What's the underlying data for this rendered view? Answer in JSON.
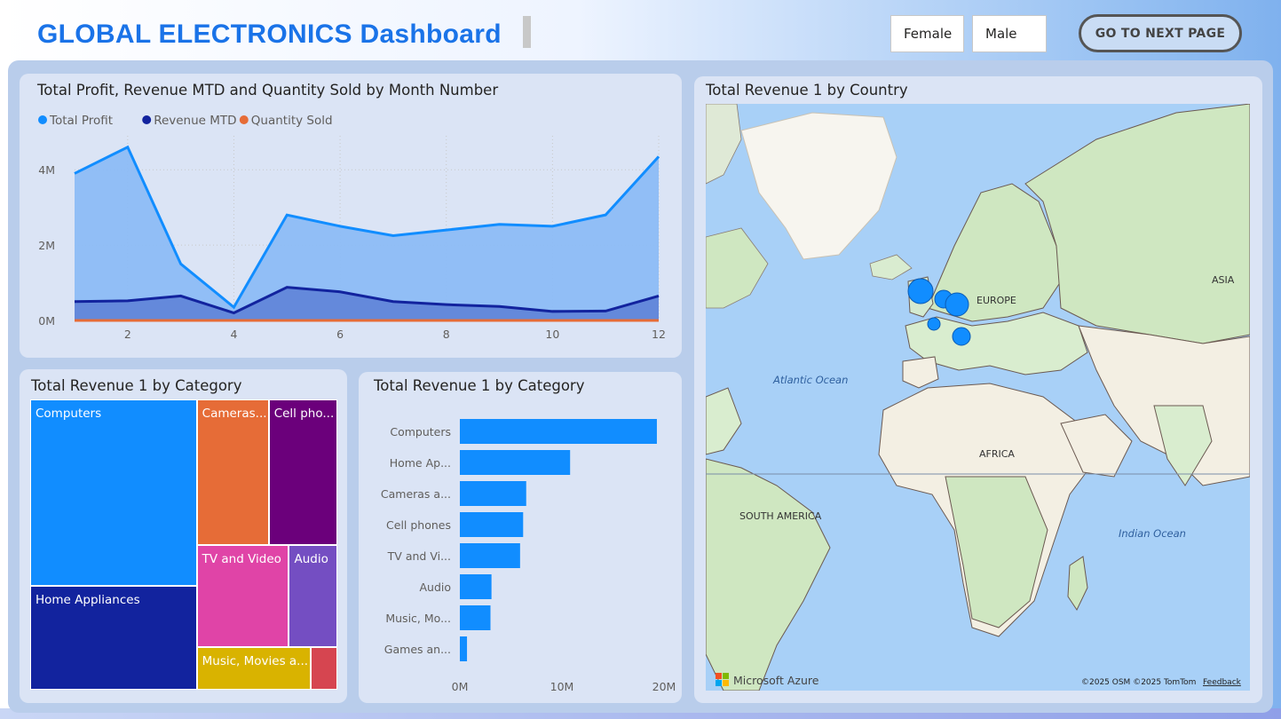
{
  "header": {
    "title": "GLOBAL ELECTRONICS Dashboard",
    "slicer_options": [
      "Female",
      "Male"
    ],
    "next_button": "GO TO NEXT PAGE"
  },
  "line_chart": {
    "title": "Total Profit, Revenue MTD and Quantity Sold by Month Number",
    "legend": [
      {
        "name": "Total Profit",
        "color": "#118DFF"
      },
      {
        "name": "Revenue MTD",
        "color": "#12239E"
      },
      {
        "name": "Quantity Sold",
        "color": "#E66C37"
      }
    ]
  },
  "treemap": {
    "title": "Total Revenue 1 by Category"
  },
  "bar_chart": {
    "title": "Total Revenue 1 by Category"
  },
  "map": {
    "title": "Total Revenue 1 by Country",
    "labels": [
      "EUROPE",
      "ASIA",
      "Atlantic Ocean",
      "AFRICA",
      "SOUTH AMERICA",
      "Indian Ocean"
    ],
    "attribution": "©2025 OSM  ©2025 TomTom",
    "feedback": "Feedback",
    "brand": "Microsoft Azure",
    "bubble_color": "#118DFF"
  },
  "chart_data": [
    {
      "type": "area",
      "title": "Total Profit, Revenue MTD and Quantity Sold by Month Number",
      "x": [
        1,
        2,
        3,
        4,
        5,
        6,
        7,
        8,
        9,
        10,
        11,
        12
      ],
      "xticks": [
        2,
        4,
        6,
        8,
        10,
        12
      ],
      "yticks": [
        "0M",
        "2M",
        "4M"
      ],
      "ylim": [
        0,
        4.9
      ],
      "series": [
        {
          "name": "Total Profit",
          "values": [
            3.9,
            4.6,
            1.5,
            0.35,
            2.8,
            2.5,
            2.25,
            2.4,
            2.55,
            2.5,
            2.8,
            4.35
          ]
        },
        {
          "name": "Revenue MTD",
          "values": [
            0.5,
            0.52,
            0.65,
            0.2,
            0.88,
            0.76,
            0.5,
            0.42,
            0.37,
            0.24,
            0.25,
            0.65
          ]
        },
        {
          "name": "Quantity Sold",
          "values": [
            0,
            0,
            0,
            0,
            0,
            0,
            0,
            0,
            0,
            0,
            0,
            0
          ]
        }
      ],
      "grid": true,
      "legend_position": "top-left"
    },
    {
      "type": "treemap",
      "title": "Total Revenue 1 by Category",
      "categories": [
        "Computers",
        "Home Appliances",
        "Cameras and camcorders",
        "Cell phones",
        "TV and Video",
        "Audio",
        "Music, Movies and Audio Books",
        "Games and Toys"
      ],
      "labels": [
        "Computers",
        "Home Appliances",
        "Cameras...",
        "Cell pho...",
        "TV and Video",
        "Audio",
        "Music, Movies a...",
        ""
      ],
      "colors": [
        "#118DFF",
        "#12239E",
        "#E66C37",
        "#6B007B",
        "#E044A7",
        "#744EC2",
        "#D9B300",
        "#D64550"
      ],
      "values": [
        19.3,
        10.8,
        6.5,
        6.2,
        5.9,
        3.1,
        3.0,
        0.7
      ]
    },
    {
      "type": "bar",
      "orientation": "horizontal",
      "title": "Total Revenue 1 by Category",
      "categories": [
        "Computers",
        "Home Ap...",
        "Cameras a...",
        "Cell phones",
        "TV and Vi...",
        "Audio",
        "Music, Mo...",
        "Games an..."
      ],
      "values": [
        19.3,
        10.8,
        6.5,
        6.2,
        5.9,
        3.1,
        3.0,
        0.7
      ],
      "xticks": [
        "0M",
        "10M",
        "20M"
      ],
      "xlim": [
        0,
        20
      ],
      "color": "#118DFF"
    }
  ]
}
